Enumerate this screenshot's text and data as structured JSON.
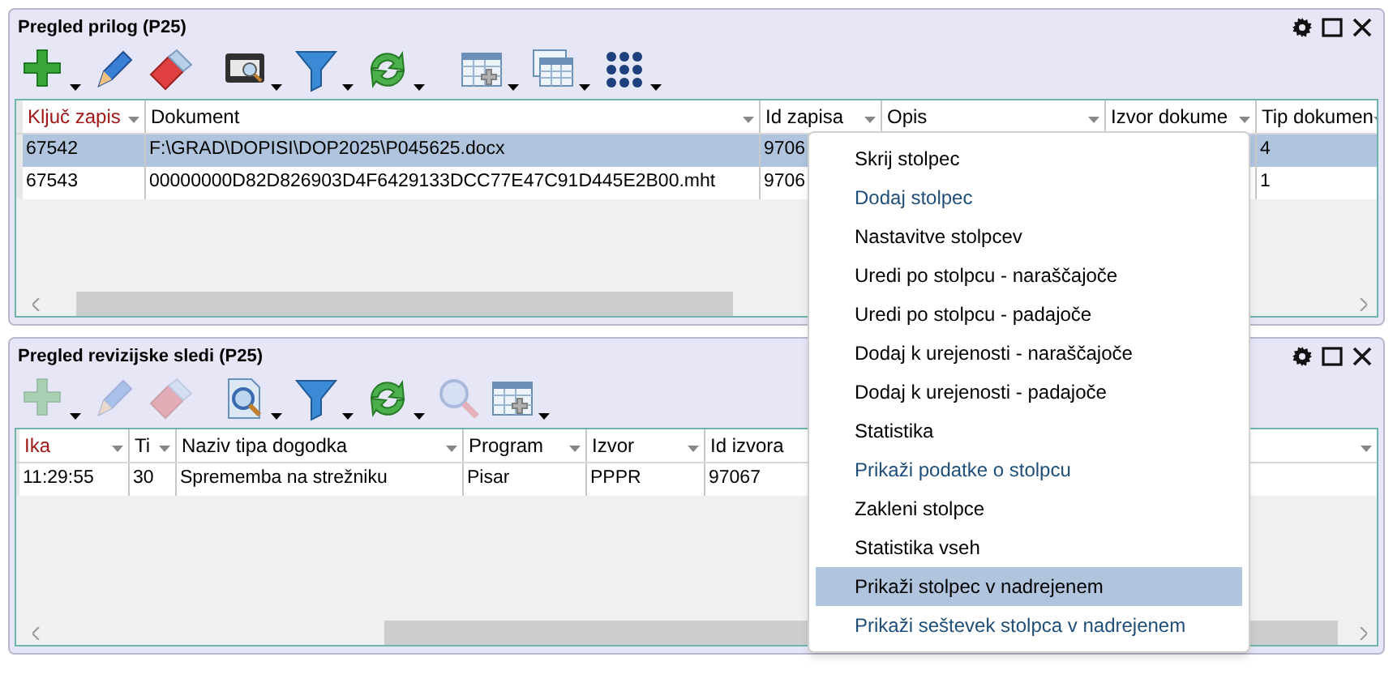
{
  "panels": [
    {
      "title": "Pregled prilog (P25)",
      "toolbar": [
        {
          "kind": "plus",
          "dropdown": true,
          "disabled": false
        },
        {
          "kind": "pencil",
          "dropdown": false,
          "disabled": false
        },
        {
          "kind": "eraser",
          "dropdown": false,
          "disabled": false
        },
        {
          "kind": "scanner",
          "dropdown": true,
          "disabled": false
        },
        {
          "kind": "filter",
          "dropdown": true,
          "disabled": false
        },
        {
          "kind": "refresh",
          "dropdown": true,
          "disabled": false
        },
        {
          "kind": "table-add",
          "dropdown": true,
          "disabled": false
        },
        {
          "kind": "tables",
          "dropdown": true,
          "disabled": false
        },
        {
          "kind": "dots",
          "dropdown": true,
          "disabled": false
        }
      ],
      "table": {
        "columns": [
          {
            "label": "Ključ zapis",
            "sorted": true
          },
          {
            "label": "Dokument",
            "sorted": false
          },
          {
            "label": "Id zapisa",
            "sorted": false
          },
          {
            "label": "Opis",
            "sorted": false
          },
          {
            "label": "Izvor dokume",
            "sorted": false
          },
          {
            "label": "Tip dokumen",
            "sorted": false
          }
        ],
        "rows": [
          {
            "selected": true,
            "cells": [
              "67542",
              "F:\\GRAD\\DOPISI\\DOP2025\\P045625.docx",
              "9706",
              null,
              null,
              "4"
            ]
          },
          {
            "selected": false,
            "cells": [
              "67543",
              "00000000D82D826903D4F6429133DCC77E47C91D445E2B00.mht",
              "9706",
              null,
              null,
              "1"
            ]
          }
        ]
      }
    },
    {
      "title": "Pregled revizijske sledi (P25)",
      "toolbar": [
        {
          "kind": "plus",
          "dropdown": true,
          "disabled": true
        },
        {
          "kind": "pencil",
          "dropdown": false,
          "disabled": true
        },
        {
          "kind": "eraser",
          "dropdown": false,
          "disabled": true
        },
        {
          "kind": "doc-search",
          "dropdown": true,
          "disabled": false
        },
        {
          "kind": "filter",
          "dropdown": true,
          "disabled": false
        },
        {
          "kind": "refresh",
          "dropdown": true,
          "disabled": false
        },
        {
          "kind": "magnifier",
          "dropdown": false,
          "disabled": true
        },
        {
          "kind": "table-add",
          "dropdown": true,
          "disabled": false
        }
      ],
      "table": {
        "columns": [
          {
            "label": "Ika",
            "sorted": true
          },
          {
            "label": "Ti",
            "sorted": false
          },
          {
            "label": "Naziv tipa dogodka",
            "sorted": false
          },
          {
            "label": "Program",
            "sorted": false
          },
          {
            "label": "Izvor",
            "sorted": false
          },
          {
            "label": "Id izvora",
            "sorted": false
          }
        ],
        "rows": [
          {
            "selected": false,
            "cells": [
              "11:29:55",
              "30",
              "Sprememba na strežniku",
              "Pisar",
              "PPPR",
              "97067"
            ]
          }
        ]
      }
    }
  ],
  "context_menu": {
    "items": [
      {
        "label": "Skrij stolpec",
        "kind": "plain",
        "selected": false
      },
      {
        "label": "Dodaj stolpec",
        "kind": "accent",
        "selected": false
      },
      {
        "label": "Nastavitve stolpcev",
        "kind": "plain",
        "selected": false
      },
      {
        "label": "Uredi po stolpcu - naraščajoče",
        "kind": "plain",
        "selected": false
      },
      {
        "label": "Uredi po stolpcu - padajoče",
        "kind": "plain",
        "selected": false
      },
      {
        "label": "Dodaj k urejenosti - naraščajoče",
        "kind": "plain",
        "selected": false
      },
      {
        "label": "Dodaj k urejenosti - padajoče",
        "kind": "plain",
        "selected": false
      },
      {
        "label": "Statistika",
        "kind": "plain",
        "selected": false
      },
      {
        "label": "Prikaži podatke o stolpcu",
        "kind": "accent",
        "selected": false
      },
      {
        "label": "Zakleni stolpce",
        "kind": "plain",
        "selected": false
      },
      {
        "label": "Statistika vseh",
        "kind": "plain",
        "selected": false
      },
      {
        "label": "Prikaži stolpec v nadrejenem",
        "kind": "plain",
        "selected": true
      },
      {
        "label": "Prikaži seštevek stolpca v nadrejenem",
        "kind": "accent",
        "selected": false
      }
    ]
  }
}
